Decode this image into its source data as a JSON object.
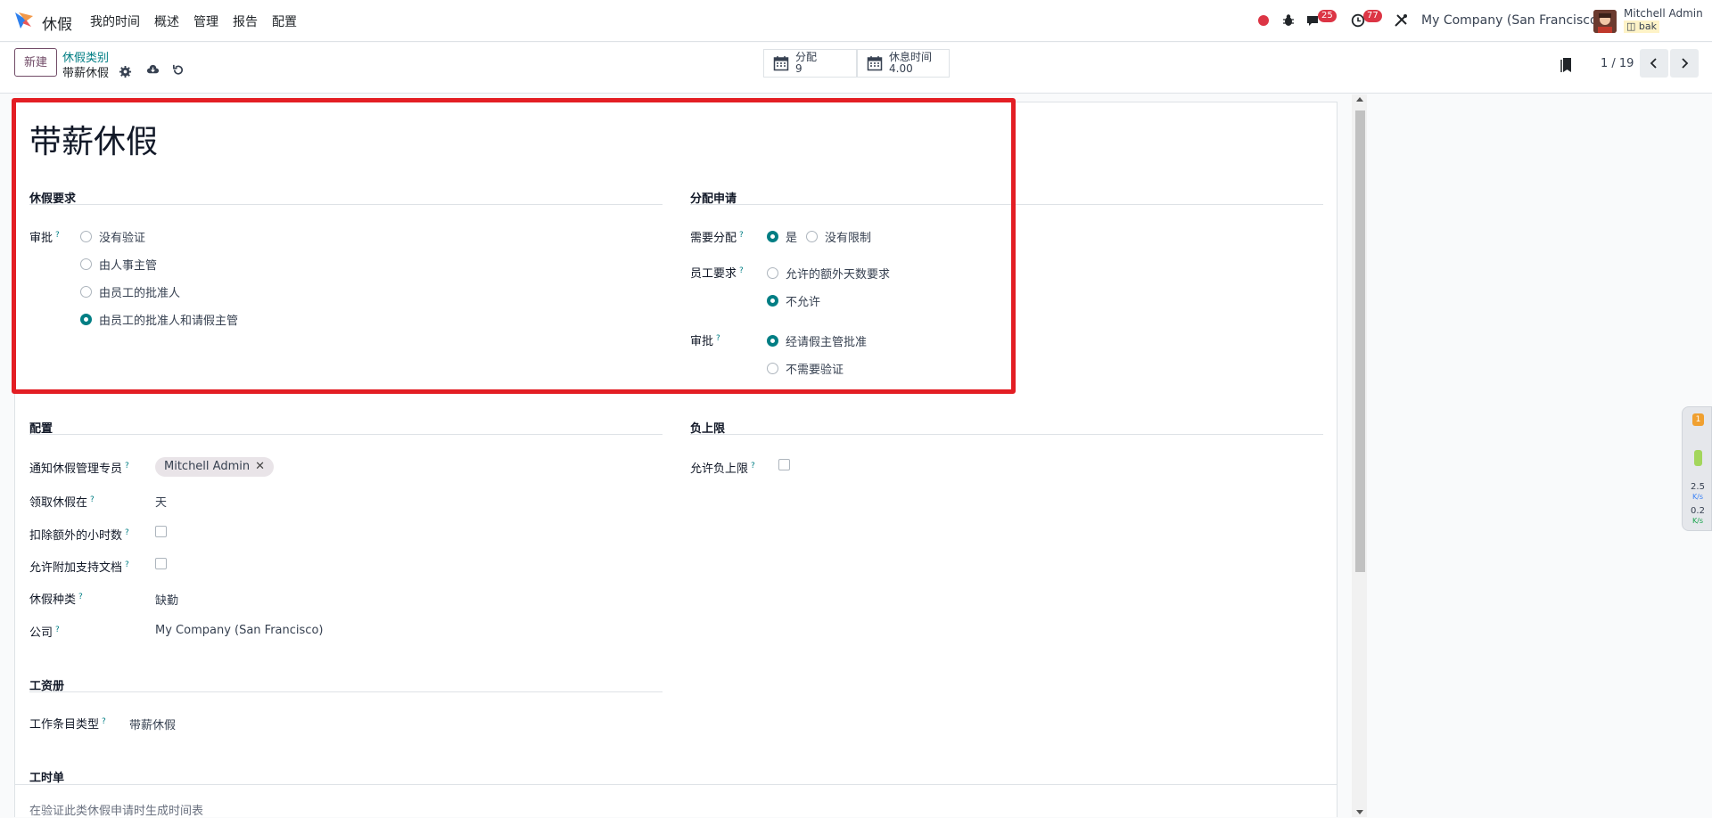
{
  "app": {
    "name": "休假",
    "menu": [
      "我的时间",
      "概述",
      "管理",
      "报告",
      "配置"
    ]
  },
  "systray": {
    "chat_badge": "25",
    "activity_badge": "77",
    "company": "My Company (San Francisco)",
    "user_name": "Mitchell Admin",
    "user_db": "bak"
  },
  "control_panel": {
    "new_button": "新建",
    "breadcrumb_parent": "休假类别",
    "breadcrumb_current": "带薪休假",
    "stat_allocations_label": "分配",
    "stat_allocations_value": "9",
    "stat_timeoff_label": "休息时间",
    "stat_timeoff_value": "4.00",
    "pager": "1 / 19"
  },
  "form": {
    "title": "带薪休假",
    "section_requests": "休假要求",
    "approval_label": "审批",
    "approval_options": [
      "没有验证",
      "由人事主管",
      "由员工的批准人",
      "由员工的批准人和请假主管"
    ],
    "approval_selected": 3,
    "section_allocation": "分配申请",
    "requires_allocation_label": "需要分配",
    "requires_allocation_options": [
      "是",
      "没有限制"
    ],
    "employee_requests_label": "员工要求",
    "employee_requests_options": [
      "允许的额外天数要求",
      "不允许"
    ],
    "allocation_approval_label": "审批",
    "allocation_approval_options": [
      "经请假主管批准",
      "不需要验证"
    ],
    "section_config": "配置",
    "notify_label": "通知休假管理专员",
    "notify_tag": "Mitchell Admin",
    "take_in_label": "领取休假在",
    "take_in_value": "天",
    "deduct_extra_label": "扣除额外的小时数",
    "attach_support_label": "允许附加支持文档",
    "kind_label": "休假种类",
    "kind_value": "缺勤",
    "company_label": "公司",
    "company_value": "My Company (San Francisco)",
    "section_negative": "负上限",
    "allow_negative_label": "允许负上限",
    "section_payroll": "工资册",
    "work_entry_label": "工作条目类型",
    "work_entry_value": "带薪休假",
    "section_timesheet": "工时单",
    "timesheet_text": "在验证此类休假申请时生成时间表"
  },
  "widget": {
    "badge": "1",
    "up": "2.5",
    "up_unit": "K/s",
    "down": "0.2",
    "down_unit": "K/s"
  },
  "colors": {
    "primary": "#714b67",
    "accent": "#017e84",
    "highlight": "#e31e24"
  }
}
